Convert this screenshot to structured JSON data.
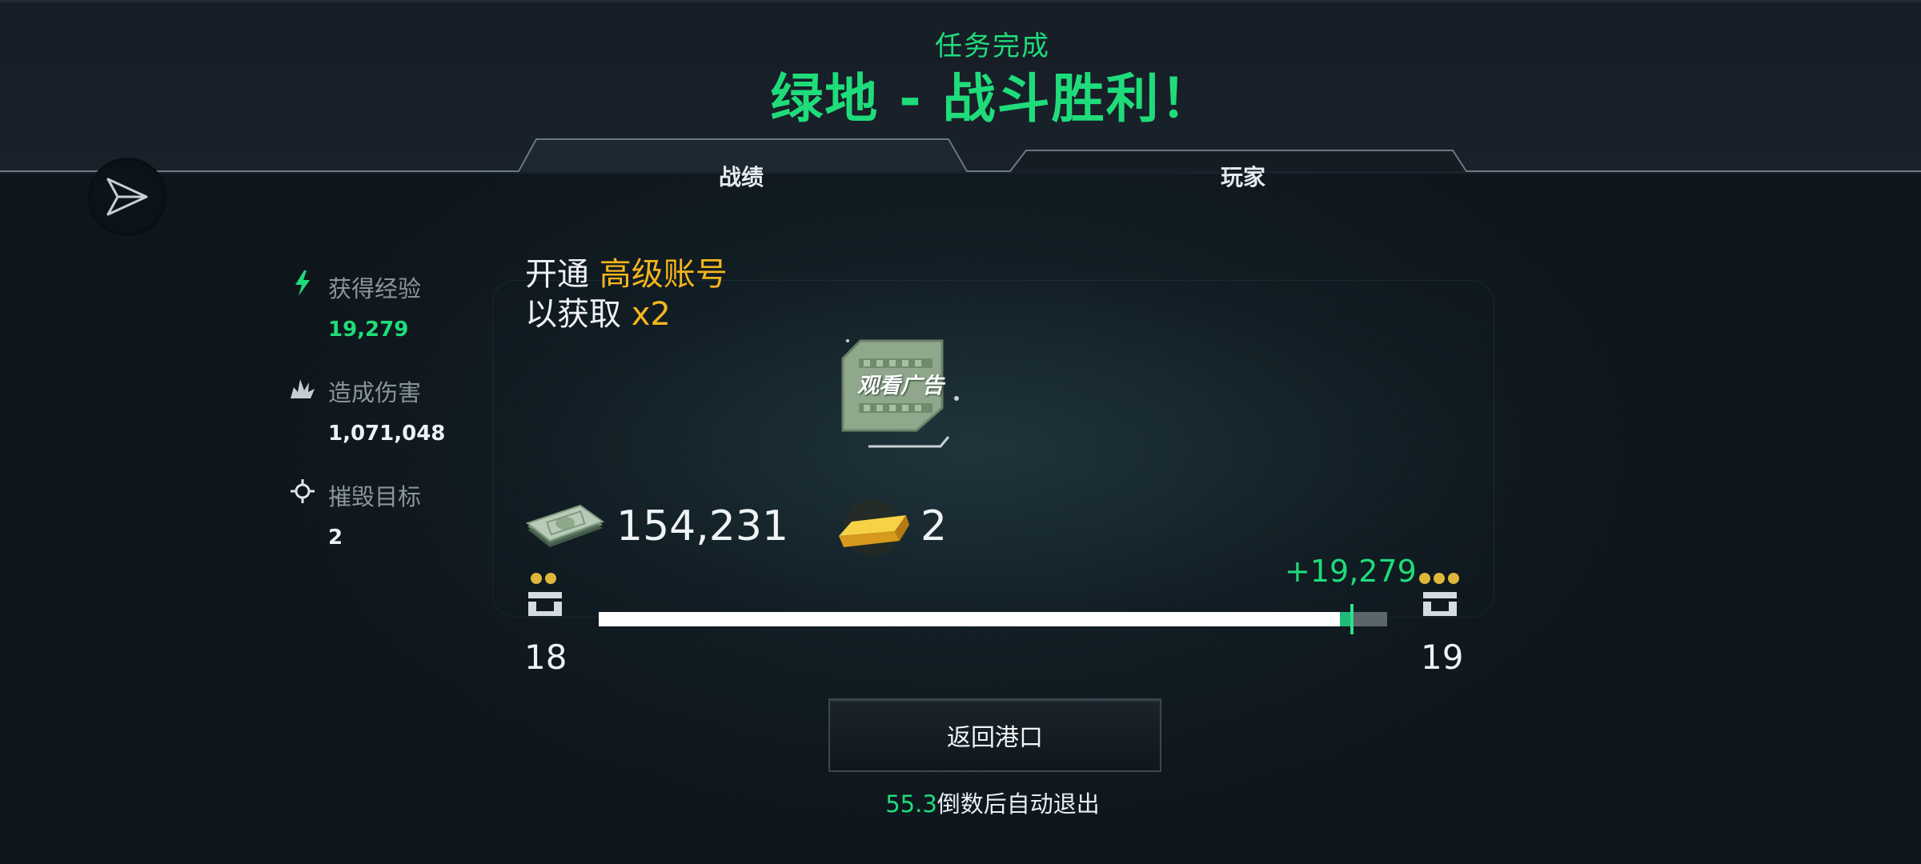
{
  "header": {
    "subtitle": "任务完成",
    "title": "绿地 - 战斗胜利！"
  },
  "tabs": [
    {
      "label": "战绩",
      "active": true
    },
    {
      "label": "玩家",
      "active": false
    }
  ],
  "stats": [
    {
      "icon": "lightning-icon",
      "label": "获得经验",
      "value": "19,279",
      "value_color": "#1fdc7a"
    },
    {
      "icon": "explosion-icon",
      "label": "造成伤害",
      "value": "1,071,048",
      "value_color": "#eef2f4"
    },
    {
      "icon": "crosshair-icon",
      "label": "摧毁目标",
      "value": "2",
      "value_color": "#eef2f4"
    }
  ],
  "promo": {
    "line1_prefix": "开通",
    "line1_highlight": "高级账号",
    "line2_prefix": "以获取",
    "line2_highlight": "x2"
  },
  "ad_button": {
    "label": "观看广告"
  },
  "rewards": {
    "money": "154,231",
    "gold": "2"
  },
  "level": {
    "current": "18",
    "next": "19",
    "xp_gain": "+19,279",
    "progress_before": 0.94,
    "progress_after": 0.955
  },
  "return_button": {
    "label": "返回港口"
  },
  "countdown": {
    "seconds": "55.3",
    "text": "倒数后自动退出"
  },
  "colors": {
    "accent": "#1fdc7a",
    "gold": "#f4b51c"
  }
}
